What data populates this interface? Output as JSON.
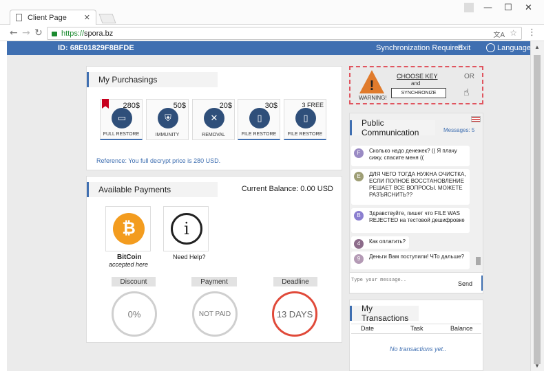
{
  "browser": {
    "tab_title": "Client Page",
    "url_scheme": "https://",
    "url_domain": "spora.bz"
  },
  "header": {
    "id_text": "ID: 68E01829F8BFDE",
    "sync_text": "Synchronization Required",
    "exit_label": "Exit",
    "language_label": "Language"
  },
  "purchasings": {
    "title": "My Purchasings",
    "items": [
      {
        "price": "280$",
        "label": "FULL RESTORE",
        "icon": "laptop-icon"
      },
      {
        "price": "50$",
        "label": "IMMUNITY",
        "icon": "shield-icon"
      },
      {
        "price": "20$",
        "label": "REMOVAL",
        "icon": "tools-icon"
      },
      {
        "price": "30$",
        "label": "FILE RESTORE",
        "icon": "file-icon"
      },
      {
        "price": "3 FREE",
        "label": "FILE RESTORE",
        "icon": "file-icon"
      }
    ],
    "reference": "Reference: You full decrypt price is 280 USD."
  },
  "payments": {
    "title": "Available Payments",
    "balance": "Current Balance: 0.00 USD",
    "bitcoin_label": "BitCoin",
    "bitcoin_sub": "accepted here",
    "help_label": "Need Help?",
    "discount_label": "Discount",
    "discount_value": "0%",
    "payment_label": "Payment",
    "payment_value": "NOT PAID",
    "deadline_label": "Deadline",
    "deadline_value": "13 DAYS"
  },
  "warning": {
    "warning_text": "WARNING!",
    "choose_key": "CHOOSE  KEY",
    "and_text": "and",
    "or_text": "OR",
    "sync_button": "SYNCHRONIZE"
  },
  "communication": {
    "title": "Public Communication",
    "messages_count": "Messages: 5",
    "messages": [
      {
        "avatar": "F",
        "text": "Сколько надо денежек? (( Я плачу сижу, спасите меня (("
      },
      {
        "avatar": "E",
        "text": "ДЛЯ ЧЕГО ТОГДА НУЖНА ОЧИСТКА, ЕСЛИ ПОЛНОЕ ВОССТАНОВЛЕНИЕ РЕШАЕТ ВСЕ ВОПРОСЫ. МОЖЕТЕ РАЗЪЯСНИТЬ??"
      },
      {
        "avatar": "B",
        "text": "Здравствуйте, пишет что FILE WAS REJECTED на тестовой дешифровке"
      },
      {
        "avatar": "4",
        "text": "Как оплатить?"
      },
      {
        "avatar": "9",
        "text": "Деньги Вам поступили! ЧТо дальше?"
      }
    ],
    "input_placeholder": "Type your message..",
    "send_label": "Send"
  },
  "transactions": {
    "title": "My Transactions",
    "columns": [
      "Date",
      "Task",
      "Balance"
    ],
    "empty_text": "No transactions yet.."
  },
  "colors": {
    "accent": "#3f6fb1",
    "bitcoin": "#f39c1f",
    "deadline": "#e04a3a"
  }
}
